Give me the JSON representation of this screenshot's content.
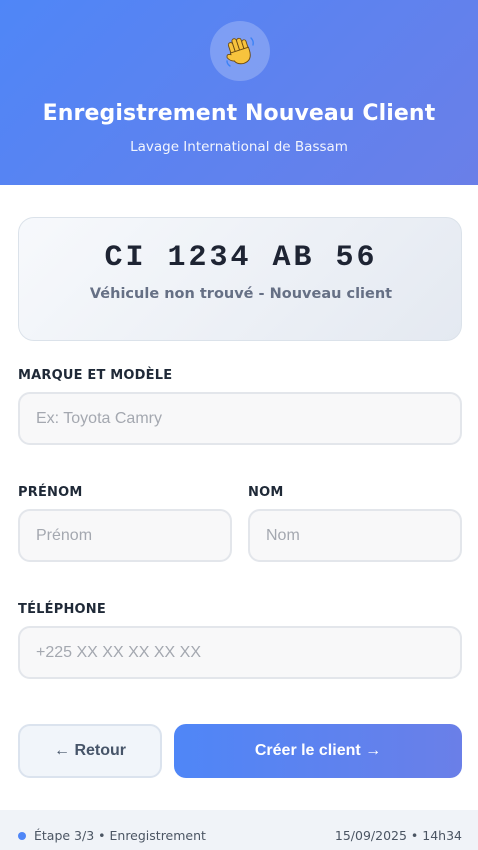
{
  "header": {
    "icon": "waving-hand-icon",
    "title": "Enregistrement Nouveau Client",
    "subtitle": "Lavage International de Bassam"
  },
  "vehicle": {
    "plate": "CI 1234 AB 56",
    "status": "Véhicule non trouvé - Nouveau client"
  },
  "form": {
    "brand_model": {
      "label": "MARQUE ET MODÈLE",
      "placeholder": "Ex: Toyota Camry",
      "value": ""
    },
    "first_name": {
      "label": "PRÉNOM",
      "placeholder": "Prénom",
      "value": ""
    },
    "last_name": {
      "label": "NOM",
      "placeholder": "Nom",
      "value": ""
    },
    "phone": {
      "label": "TÉLÉPHONE",
      "placeholder": "+225 XX XX XX XX XX",
      "value": ""
    }
  },
  "actions": {
    "back_label": "← Retour",
    "create_label": "Créer le client →"
  },
  "footer": {
    "step": "Étape 3/3 • Enregistrement",
    "datetime": "15/09/2025 • 14h34"
  },
  "colors": {
    "accent": "#4f86f7",
    "accent_secondary": "#6a7fe8",
    "footer_bg": "#f0f3f8"
  }
}
